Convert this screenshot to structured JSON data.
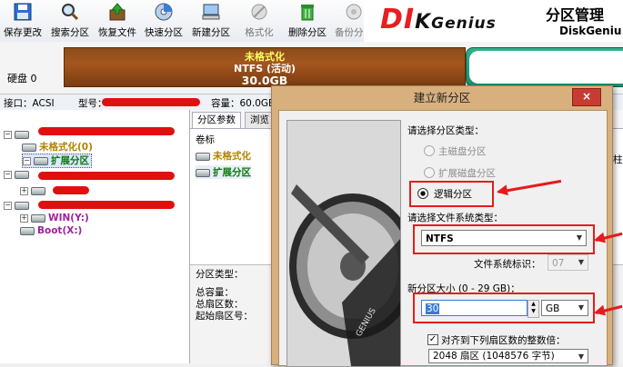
{
  "toolbar": {
    "buttons": [
      {
        "label": "保存更改",
        "icon": "save-icon"
      },
      {
        "label": "搜索分区",
        "icon": "search-icon"
      },
      {
        "label": "恢复文件",
        "icon": "restore-file-icon"
      },
      {
        "label": "快速分区",
        "icon": "quick-partition-icon"
      },
      {
        "label": "新建分区",
        "icon": "new-partition-icon"
      },
      {
        "label": "格式化",
        "icon": "format-icon"
      },
      {
        "label": "删除分区",
        "icon": "delete-icon"
      },
      {
        "label": "备份分区",
        "icon": "backup-icon"
      }
    ]
  },
  "brand": {
    "logo": "DISKGenius",
    "logo_main": "DI",
    "logo_k": "K",
    "logo_rest": "Genius",
    "title": "分区管理",
    "subtitle": "DiskGeniu"
  },
  "disk": {
    "label": "硬盘 0",
    "partition_bar": {
      "line1": "未格式化",
      "line2": "NTFS (活动)",
      "line3": "30.0GB"
    }
  },
  "info_line": {
    "interface": "接口：ACSI",
    "model_label": "型号：",
    "capacity": "容量：60.0GB"
  },
  "tree": {
    "nodes": [
      {
        "label": "未格式化(0)"
      },
      {
        "label": "扩展分区"
      },
      {
        "label": "WIN(Y:)"
      },
      {
        "label": "Boot(X:)"
      }
    ]
  },
  "right_panel": {
    "tabs": [
      "分区参数",
      "浏览"
    ],
    "header": "卷标",
    "rows": [
      "未格式化",
      "扩展分区"
    ],
    "bottom_labels": {
      "type": "分区类型：",
      "capacity": "总容量：",
      "sectors": "总扇区数：",
      "start": "起始扇区号："
    },
    "right_edge_label": "终止柱"
  },
  "dialog": {
    "title": "建立新分区",
    "close": "×",
    "partition_type_label": "请选择分区类型：",
    "radio_primary": "主磁盘分区",
    "radio_extended": "扩展磁盘分区",
    "radio_logical": "逻辑分区",
    "fs_label": "请选择文件系统类型：",
    "fs_value": "NTFS",
    "fs_id_label": "文件系统标识：",
    "fs_id_value": "07",
    "size_label": "新分区大小 (0 - 29 GB)：",
    "size_value": "30",
    "size_unit": "GB",
    "align_label": "对齐到下列扇区数的整数倍：",
    "align_value": "2048 扇区 (1048576 字节)"
  },
  "colors": {
    "accent_red": "#e51c1c",
    "partition_brown": "#a5561e",
    "dialog_frame": "#d7b07e"
  }
}
